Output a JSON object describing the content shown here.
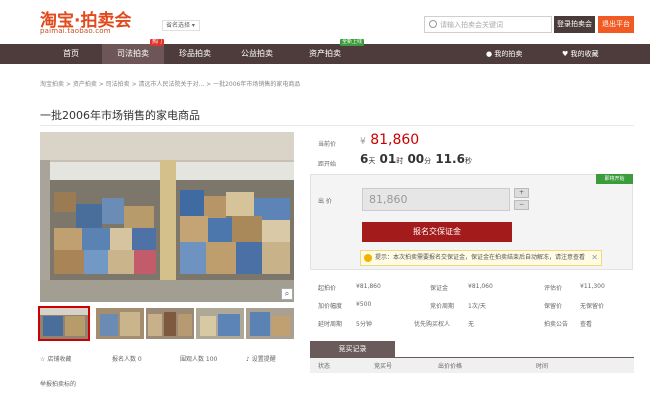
{
  "header": {
    "logo_main": "淘宝·拍卖会",
    "logo_sub": "paimai.taobao.com",
    "city_select": "省名选择 ▾",
    "search_placeholder": "请输入拍卖会关键词",
    "btn_login": "登录拍卖会",
    "btn_register": "退出平台"
  },
  "nav": {
    "items": [
      {
        "label": "首页"
      },
      {
        "label": "司法拍卖",
        "badge": "热门"
      },
      {
        "label": "珍品拍卖"
      },
      {
        "label": "公益拍卖"
      },
      {
        "label": "资产拍卖",
        "badge": "全新上线"
      }
    ],
    "right": [
      "我的拍卖",
      "我的收藏"
    ],
    "badge_hot_color": "#e0332c",
    "badge_new_color": "#3a9c3a"
  },
  "breadcrumb": "淘宝拍卖 > 资产拍卖 > 司法拍卖 > 清远市人民法院关于对... > 一批2006年市场销售的家电商品",
  "title": "一批2006年市场销售的家电商品",
  "gallery": {
    "zoom_icon": "search-icon",
    "meta": [
      "店铺收藏",
      "报名人数 0",
      "围观人数 100",
      "设置提醒"
    ],
    "report": "举报拍卖标的"
  },
  "auction": {
    "current_price_label": "当前价",
    "current_price_yen": "¥",
    "current_price": "81,860",
    "countdown_label": "距开始",
    "countdown": {
      "d": "6",
      "d_u": "天",
      "h": "01",
      "h_u": "时",
      "m": "00",
      "m_u": "分",
      "s": "11.6",
      "s_u": "秒"
    },
    "status_flag": "即将开始",
    "bid_label": "出 价",
    "bid_value": "81,860",
    "bid_button": "报名交保证金",
    "tip": "提示：本次拍卖需要报名交保证金，保证金在拍卖结束后自动解冻，请注意查看"
  },
  "info": [
    [
      "起拍价",
      "¥81,860",
      "保证金",
      "¥81,060",
      "评估价",
      "¥11,300"
    ],
    [
      "加价幅度",
      "¥500",
      "竞价周期",
      "1次/天",
      "保留价",
      "无保留价"
    ],
    [
      "延时周期",
      "5分钟",
      "优先购买权人",
      "无",
      "拍卖公告",
      "查看"
    ]
  ],
  "records": {
    "tab": "竞买记录",
    "cols": [
      "状态",
      "竞买号",
      "出价价格",
      "时间"
    ]
  }
}
